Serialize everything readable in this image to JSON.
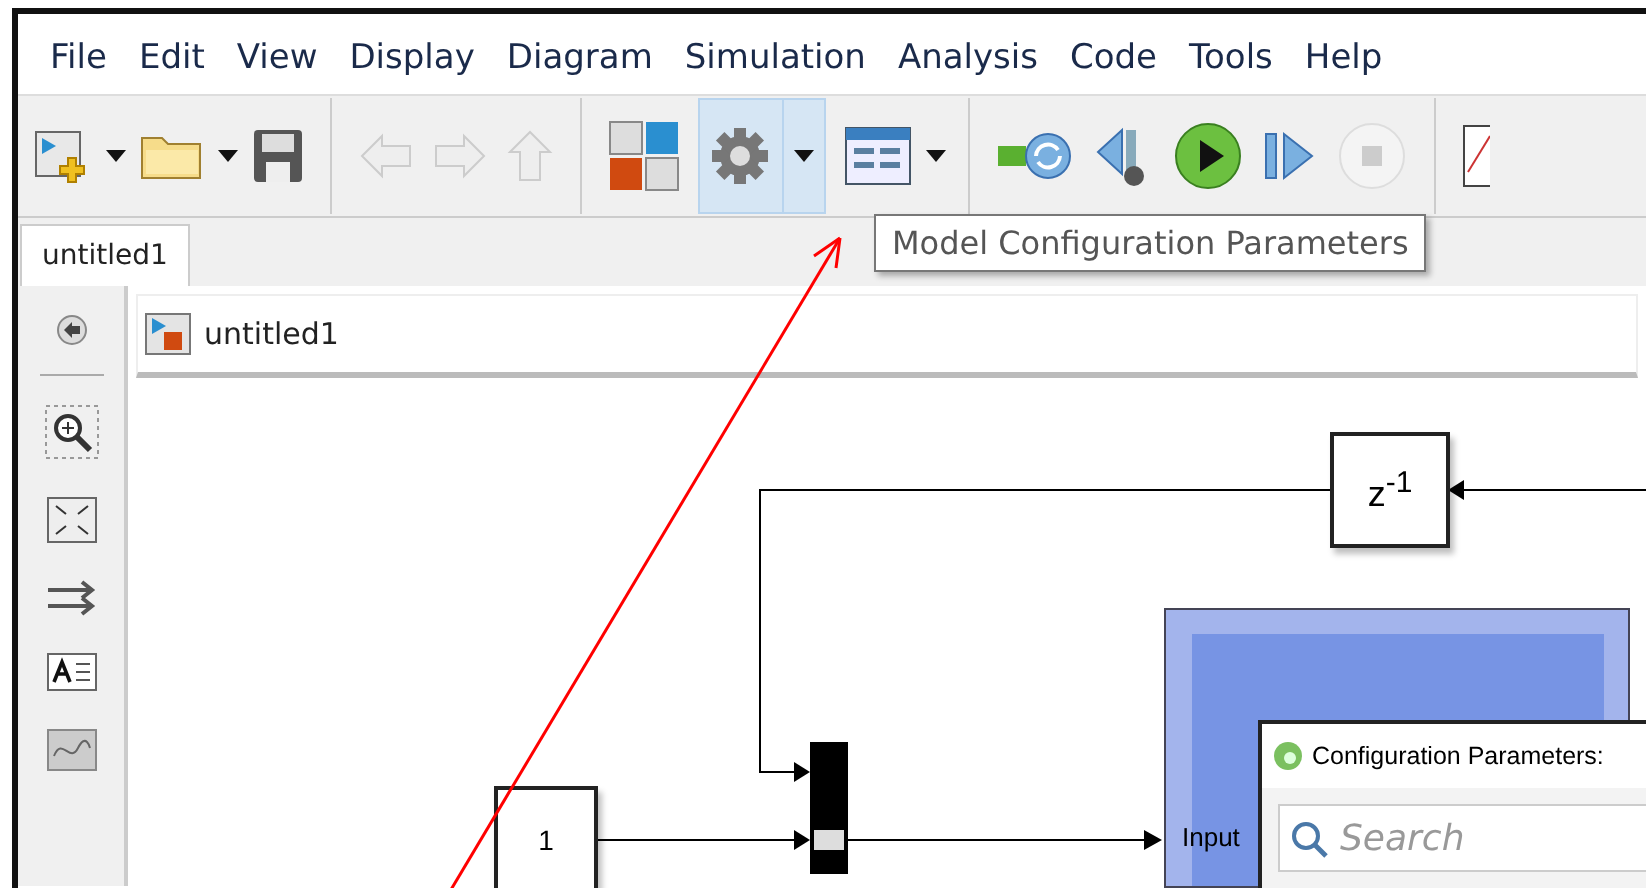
{
  "menu": [
    "File",
    "Edit",
    "View",
    "Display",
    "Diagram",
    "Simulation",
    "Analysis",
    "Code",
    "Tools",
    "Help"
  ],
  "toolbar": {
    "tooltip": "Model Configuration Parameters"
  },
  "tabs": [
    {
      "label": "untitled1",
      "selected": true
    }
  ],
  "address_bar": {
    "label": "untitled1"
  },
  "diagram": {
    "delay_block": "z$^{-1}$",
    "constant_block": "1",
    "subsystem_port": "Input"
  },
  "dialog": {
    "title": "Configuration Parameters:",
    "search": {
      "placeholder": "Search"
    }
  }
}
